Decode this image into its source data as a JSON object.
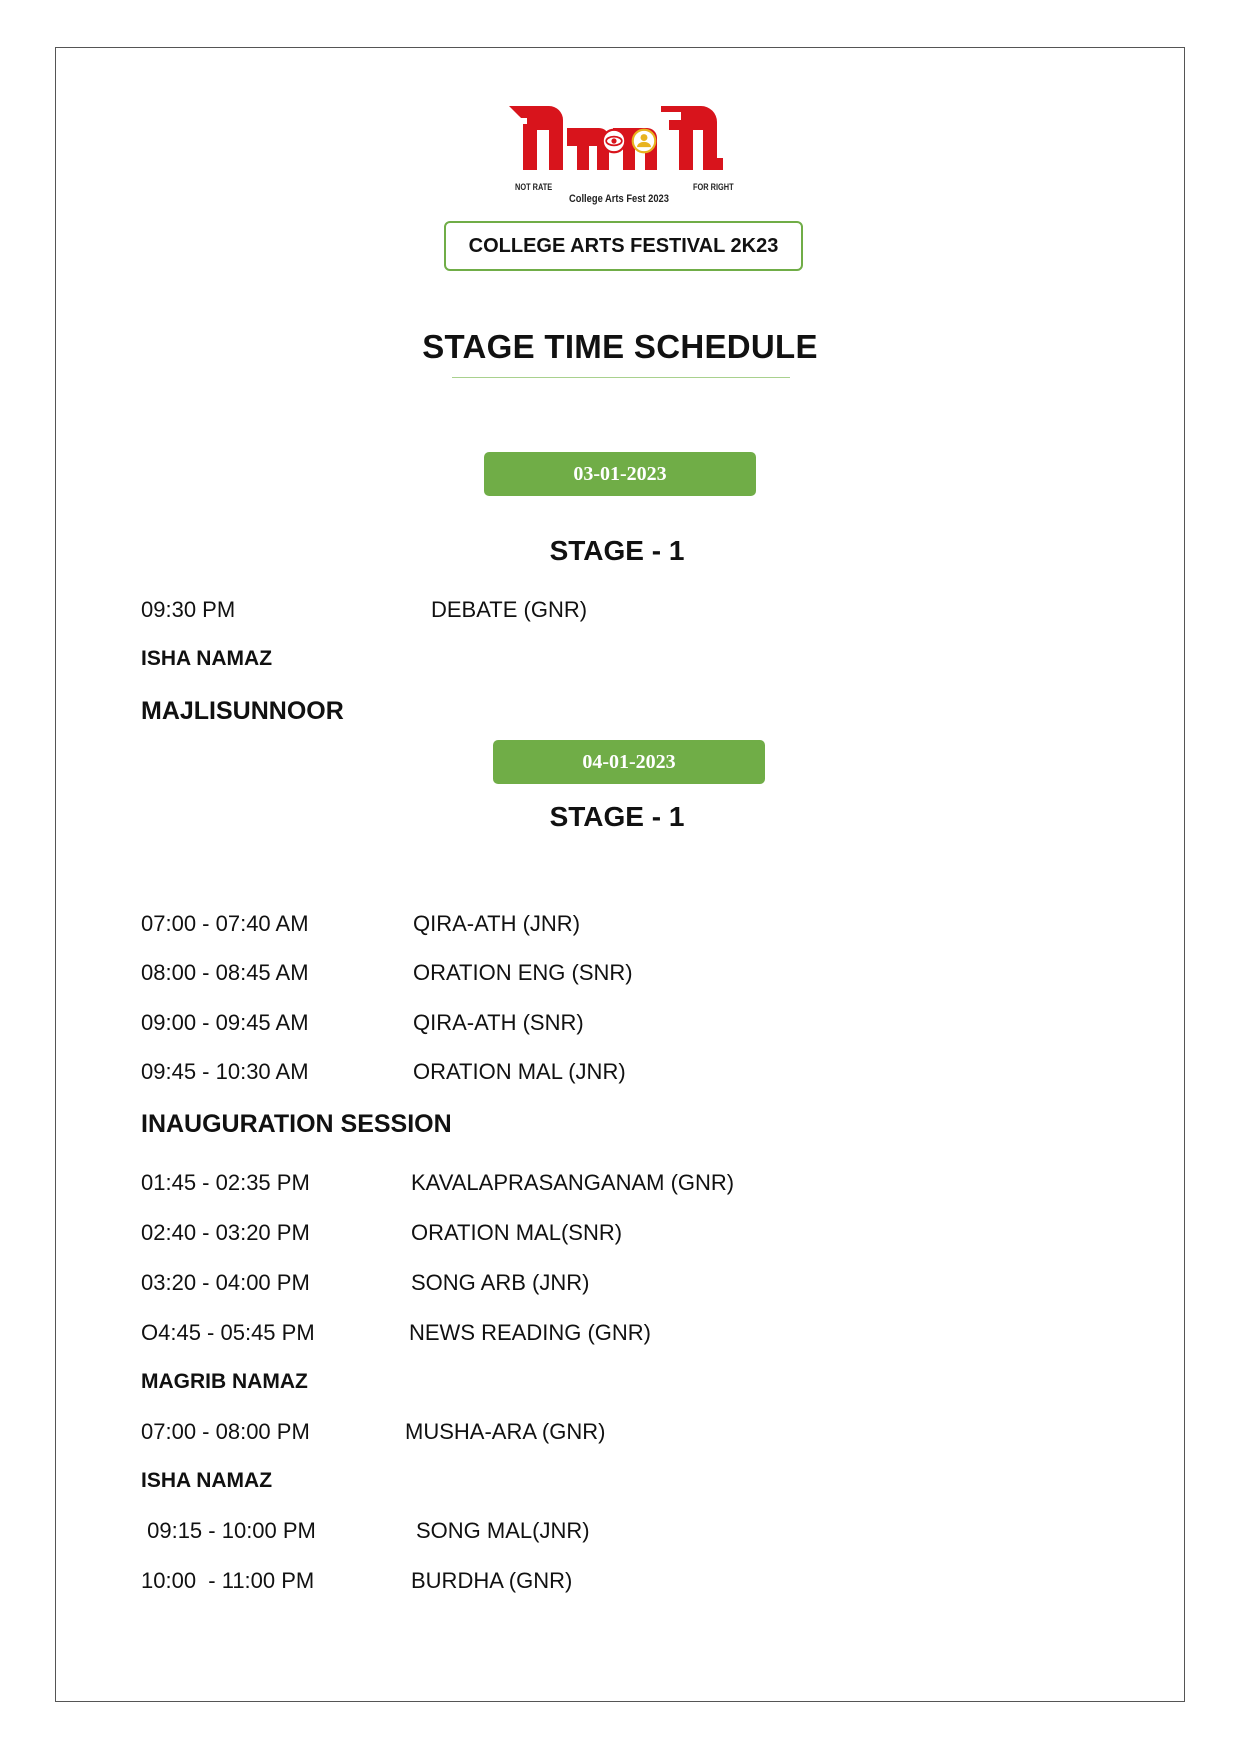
{
  "logo": {
    "wordmark_color": "#d8141c",
    "eye_icon": "eye-icon",
    "person_icon": "person-icon",
    "tag_left": "NOT RATE",
    "tag_right": "FOR RIGHT",
    "subtitle": "College Arts Fest 2023"
  },
  "festival_label": "COLLEGE ARTS FESTIVAL 2K23",
  "title": "STAGE TIME SCHEDULE",
  "accent_color": "#70ad47",
  "day1": {
    "date": "03-01-2023",
    "stage": "STAGE - 1",
    "entries": [
      {
        "time": "09:30 PM",
        "event": "DEBATE (GNR)"
      }
    ],
    "breaks": [
      "ISHA NAMAZ"
    ],
    "session": "MAJLISUNNOOR"
  },
  "day2": {
    "date": "04-01-2023",
    "stage": "STAGE - 1",
    "morning": [
      {
        "time": "07:00 - 07:40 AM",
        "event": "QIRA-ATH (JNR)"
      },
      {
        "time": "08:00 - 08:45 AM",
        "event": "ORATION ENG (SNR)"
      },
      {
        "time": "09:00 - 09:45 AM",
        "event": "QIRA-ATH (SNR)"
      },
      {
        "time": "09:45 - 10:30 AM",
        "event": "ORATION MAL (JNR)"
      }
    ],
    "session": "INAUGURATION SESSION",
    "afternoon": [
      {
        "time": "01:45 - 02:35 PM",
        "event": "KAVALAPRASANGANAM (GNR)"
      },
      {
        "time": "02:40 - 03:20 PM",
        "event": "ORATION MAL(SNR)"
      },
      {
        "time": "03:20 - 04:00 PM",
        "event": "SONG ARB (JNR)"
      },
      {
        "time": "O4:45 - 05:45 PM",
        "event": "NEWS READING (GNR)"
      }
    ],
    "break_1": "MAGRIB NAMAZ",
    "evening": [
      {
        "time": "07:00 - 08:00 PM",
        "event": "MUSHA-ARA (GNR)"
      }
    ],
    "break_2": "ISHA NAMAZ",
    "night": [
      {
        "time": " 09:15 - 10:00 PM",
        "event": "SONG MAL(JNR)"
      },
      {
        "time": "10:00  - 11:00 PM",
        "event": "BURDHA (GNR)"
      }
    ]
  }
}
